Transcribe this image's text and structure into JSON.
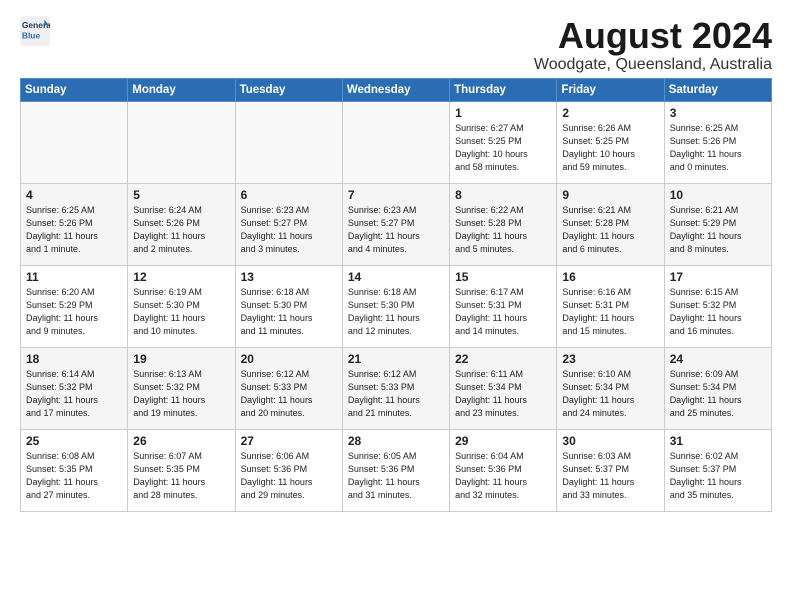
{
  "header": {
    "logo_line1": "General",
    "logo_line2": "Blue",
    "month": "August 2024",
    "location": "Woodgate, Queensland, Australia"
  },
  "days_of_week": [
    "Sunday",
    "Monday",
    "Tuesday",
    "Wednesday",
    "Thursday",
    "Friday",
    "Saturday"
  ],
  "weeks": [
    [
      {
        "day": "",
        "info": ""
      },
      {
        "day": "",
        "info": ""
      },
      {
        "day": "",
        "info": ""
      },
      {
        "day": "",
        "info": ""
      },
      {
        "day": "1",
        "info": "Sunrise: 6:27 AM\nSunset: 5:25 PM\nDaylight: 10 hours\nand 58 minutes."
      },
      {
        "day": "2",
        "info": "Sunrise: 6:26 AM\nSunset: 5:25 PM\nDaylight: 10 hours\nand 59 minutes."
      },
      {
        "day": "3",
        "info": "Sunrise: 6:25 AM\nSunset: 5:26 PM\nDaylight: 11 hours\nand 0 minutes."
      }
    ],
    [
      {
        "day": "4",
        "info": "Sunrise: 6:25 AM\nSunset: 5:26 PM\nDaylight: 11 hours\nand 1 minute."
      },
      {
        "day": "5",
        "info": "Sunrise: 6:24 AM\nSunset: 5:26 PM\nDaylight: 11 hours\nand 2 minutes."
      },
      {
        "day": "6",
        "info": "Sunrise: 6:23 AM\nSunset: 5:27 PM\nDaylight: 11 hours\nand 3 minutes."
      },
      {
        "day": "7",
        "info": "Sunrise: 6:23 AM\nSunset: 5:27 PM\nDaylight: 11 hours\nand 4 minutes."
      },
      {
        "day": "8",
        "info": "Sunrise: 6:22 AM\nSunset: 5:28 PM\nDaylight: 11 hours\nand 5 minutes."
      },
      {
        "day": "9",
        "info": "Sunrise: 6:21 AM\nSunset: 5:28 PM\nDaylight: 11 hours\nand 6 minutes."
      },
      {
        "day": "10",
        "info": "Sunrise: 6:21 AM\nSunset: 5:29 PM\nDaylight: 11 hours\nand 8 minutes."
      }
    ],
    [
      {
        "day": "11",
        "info": "Sunrise: 6:20 AM\nSunset: 5:29 PM\nDaylight: 11 hours\nand 9 minutes."
      },
      {
        "day": "12",
        "info": "Sunrise: 6:19 AM\nSunset: 5:30 PM\nDaylight: 11 hours\nand 10 minutes."
      },
      {
        "day": "13",
        "info": "Sunrise: 6:18 AM\nSunset: 5:30 PM\nDaylight: 11 hours\nand 11 minutes."
      },
      {
        "day": "14",
        "info": "Sunrise: 6:18 AM\nSunset: 5:30 PM\nDaylight: 11 hours\nand 12 minutes."
      },
      {
        "day": "15",
        "info": "Sunrise: 6:17 AM\nSunset: 5:31 PM\nDaylight: 11 hours\nand 14 minutes."
      },
      {
        "day": "16",
        "info": "Sunrise: 6:16 AM\nSunset: 5:31 PM\nDaylight: 11 hours\nand 15 minutes."
      },
      {
        "day": "17",
        "info": "Sunrise: 6:15 AM\nSunset: 5:32 PM\nDaylight: 11 hours\nand 16 minutes."
      }
    ],
    [
      {
        "day": "18",
        "info": "Sunrise: 6:14 AM\nSunset: 5:32 PM\nDaylight: 11 hours\nand 17 minutes."
      },
      {
        "day": "19",
        "info": "Sunrise: 6:13 AM\nSunset: 5:32 PM\nDaylight: 11 hours\nand 19 minutes."
      },
      {
        "day": "20",
        "info": "Sunrise: 6:12 AM\nSunset: 5:33 PM\nDaylight: 11 hours\nand 20 minutes."
      },
      {
        "day": "21",
        "info": "Sunrise: 6:12 AM\nSunset: 5:33 PM\nDaylight: 11 hours\nand 21 minutes."
      },
      {
        "day": "22",
        "info": "Sunrise: 6:11 AM\nSunset: 5:34 PM\nDaylight: 11 hours\nand 23 minutes."
      },
      {
        "day": "23",
        "info": "Sunrise: 6:10 AM\nSunset: 5:34 PM\nDaylight: 11 hours\nand 24 minutes."
      },
      {
        "day": "24",
        "info": "Sunrise: 6:09 AM\nSunset: 5:34 PM\nDaylight: 11 hours\nand 25 minutes."
      }
    ],
    [
      {
        "day": "25",
        "info": "Sunrise: 6:08 AM\nSunset: 5:35 PM\nDaylight: 11 hours\nand 27 minutes."
      },
      {
        "day": "26",
        "info": "Sunrise: 6:07 AM\nSunset: 5:35 PM\nDaylight: 11 hours\nand 28 minutes."
      },
      {
        "day": "27",
        "info": "Sunrise: 6:06 AM\nSunset: 5:36 PM\nDaylight: 11 hours\nand 29 minutes."
      },
      {
        "day": "28",
        "info": "Sunrise: 6:05 AM\nSunset: 5:36 PM\nDaylight: 11 hours\nand 31 minutes."
      },
      {
        "day": "29",
        "info": "Sunrise: 6:04 AM\nSunset: 5:36 PM\nDaylight: 11 hours\nand 32 minutes."
      },
      {
        "day": "30",
        "info": "Sunrise: 6:03 AM\nSunset: 5:37 PM\nDaylight: 11 hours\nand 33 minutes."
      },
      {
        "day": "31",
        "info": "Sunrise: 6:02 AM\nSunset: 5:37 PM\nDaylight: 11 hours\nand 35 minutes."
      }
    ]
  ]
}
